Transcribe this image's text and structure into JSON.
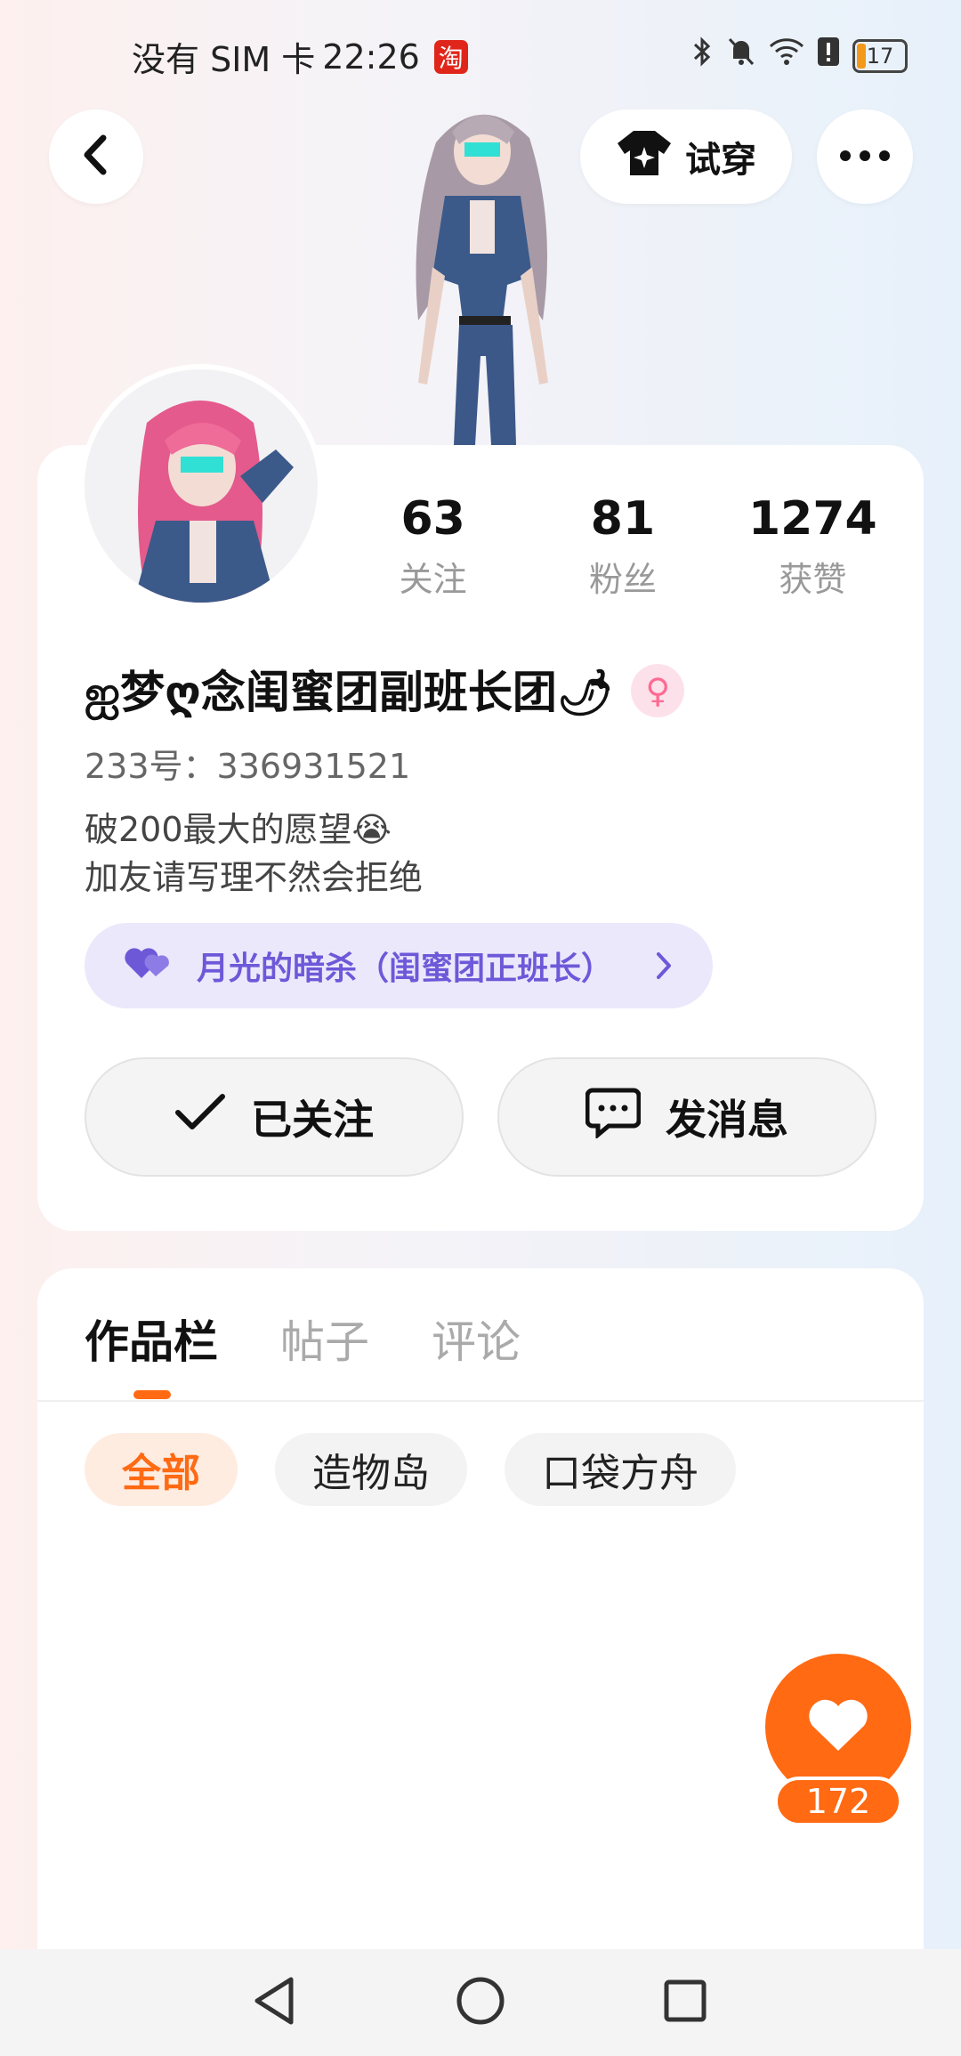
{
  "status_bar": {
    "carrier": "没有 SIM 卡",
    "time": "22:26",
    "app_badge": "淘",
    "battery_level": "17"
  },
  "header": {
    "tryon_label": "试穿"
  },
  "profile": {
    "stats": [
      {
        "value": "63",
        "label": "关注"
      },
      {
        "value": "81",
        "label": "粉丝"
      },
      {
        "value": "1274",
        "label": "获赞"
      }
    ],
    "nickname": "ஐ梦ღ念闺蜜团副班长团🌶",
    "gender_symbol": "♀",
    "user_id": "233号：336931521",
    "bio_lines": [
      "破200最大的愿望😭",
      "加友请写理不然会拒绝"
    ],
    "cp_link_label": "月光的暗杀（闺蜜团正班长）",
    "follow_label": "已关注",
    "message_label": "发消息"
  },
  "works": {
    "tabs": [
      "作品栏",
      "帖子",
      "评论"
    ],
    "active_tab": 0,
    "chips": [
      "全部",
      "造物岛",
      "口袋方舟"
    ],
    "active_chip": 0
  },
  "like_fab": {
    "count": "172"
  },
  "colors": {
    "accent": "#ff6a13",
    "cp_pill_bg": "#ebe8fc",
    "cp_pill_text": "#6d59d8"
  }
}
